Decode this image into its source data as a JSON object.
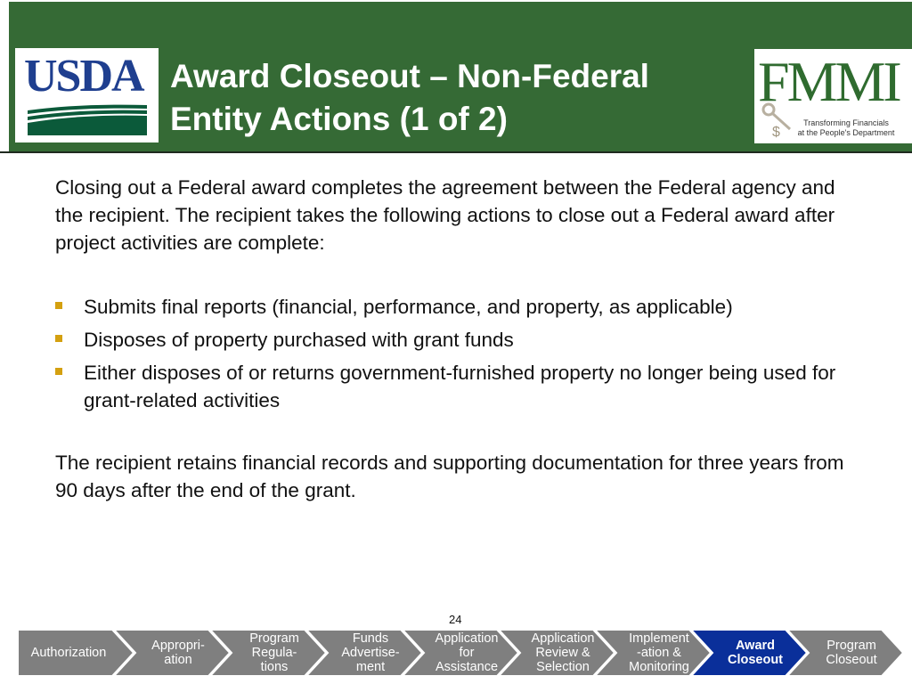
{
  "header": {
    "title_line1": "Award Closeout – Non-Federal",
    "title_line2": "Entity Actions (1 of 2)",
    "left_logo": {
      "text": "USDA",
      "icon": "usda-landscape-icon"
    },
    "right_logo": {
      "text": "FMMI",
      "tagline_line1": "Transforming Financials",
      "tagline_line2": "at the People's Department",
      "icon": "key-dollar-icon"
    },
    "background_color": "#356a35"
  },
  "content": {
    "intro": "Closing out a Federal award completes the agreement between the Federal agency and the recipient. The recipient takes the following actions to close out a Federal award after project activities are complete:",
    "bullets": [
      "Submits final reports (financial, performance, and property, as applicable)",
      "Disposes of property purchased with grant funds",
      "Either disposes of or returns government-furnished property no longer being used for grant-related activities"
    ],
    "outro": "The recipient retains financial records and supporting documentation for three years from 90 days after the end of the grant.",
    "bullet_color": "#d4a010"
  },
  "page_number": "24",
  "process": {
    "active_color": "#0a2f9a",
    "inactive_color": "#7f7f7f",
    "steps": [
      {
        "label_lines": [
          "Authorization"
        ],
        "active": false
      },
      {
        "label_lines": [
          "Appropri-",
          "ation"
        ],
        "active": false
      },
      {
        "label_lines": [
          "Program",
          "Regula-",
          "tions"
        ],
        "active": false
      },
      {
        "label_lines": [
          "Funds",
          "Advertise-",
          "ment"
        ],
        "active": false
      },
      {
        "label_lines": [
          "Application",
          "for",
          "Assistance"
        ],
        "active": false
      },
      {
        "label_lines": [
          "Application",
          "Review &",
          "Selection"
        ],
        "active": false
      },
      {
        "label_lines": [
          "Implement",
          "-ation &",
          "Monitoring"
        ],
        "active": false
      },
      {
        "label_lines": [
          "Award",
          "Closeout"
        ],
        "active": true
      },
      {
        "label_lines": [
          "Program",
          "Closeout"
        ],
        "active": false
      }
    ]
  }
}
